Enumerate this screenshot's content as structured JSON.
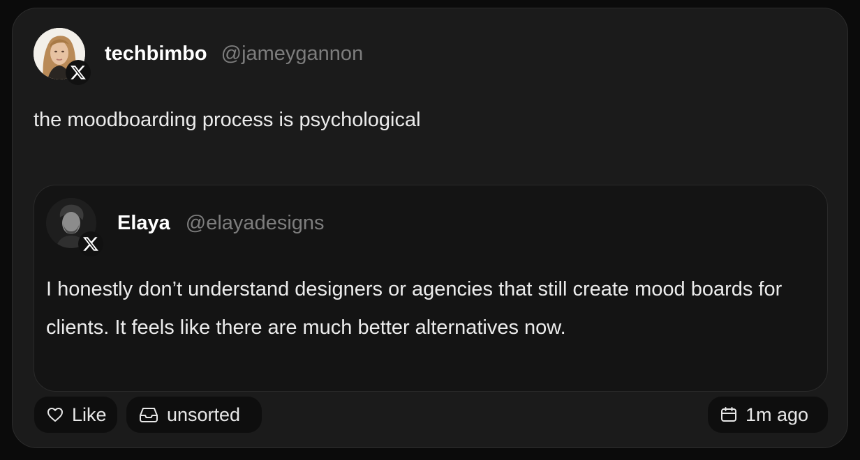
{
  "post": {
    "author": {
      "name": "techbimbo",
      "handle": "@jameygannon"
    },
    "text": "the moodboarding process is psychological",
    "quoted": {
      "author": {
        "name": "Elaya",
        "handle": "@elayadesigns"
      },
      "text": "I honestly don’t understand designers or agencies that still create mood boards for clients. It feels like there are much better alternatives now."
    }
  },
  "actions": {
    "like_label": "Like",
    "collection_label": "unsorted",
    "timestamp": "1m ago"
  },
  "icons": {
    "platform": "x-logo-icon",
    "like": "heart-icon",
    "collection": "inbox-icon",
    "timestamp": "calendar-icon"
  },
  "colors": {
    "background": "#0b0b0b",
    "card": "#1b1b1b",
    "quote_card": "#141414",
    "pill": "#0e0e0e",
    "handle": "#7d7d7d",
    "text": "#ececec"
  }
}
